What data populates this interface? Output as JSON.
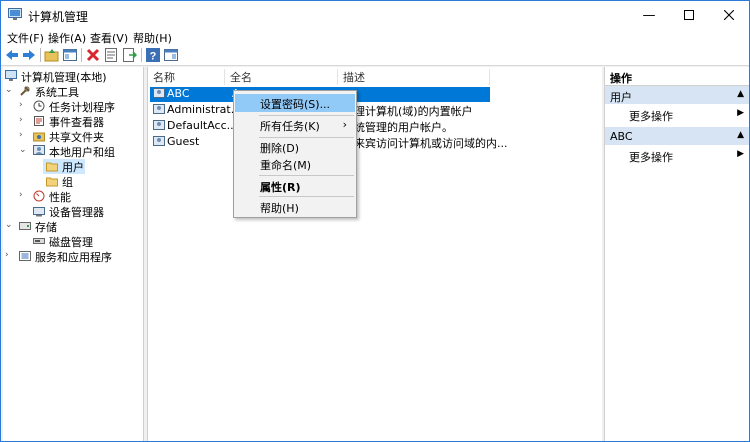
{
  "window": {
    "title": "计算机管理"
  },
  "menu": {
    "file": "文件(F)",
    "action": "操作(A)",
    "view": "查看(V)",
    "help": "帮助(H)"
  },
  "tree": {
    "root": "计算机管理(本地)",
    "system_tools": "系统工具",
    "task_scheduler": "任务计划程序",
    "event_viewer": "事件查看器",
    "shared_folders": "共享文件夹",
    "local_users_groups": "本地用户和组",
    "users": "用户",
    "groups": "组",
    "performance": "性能",
    "device_manager": "设备管理器",
    "storage": "存储",
    "disk_management": "磁盘管理",
    "services_apps": "服务和应用程序"
  },
  "list": {
    "columns": {
      "name": "名称",
      "fullname": "全名",
      "description": "描述"
    },
    "rows": [
      {
        "name": "ABC",
        "fullname": "A",
        "description": ""
      },
      {
        "name": "Administrat...",
        "fullname": "",
        "description": "管理计算机(域)的内置帐户"
      },
      {
        "name": "DefaultAcc...",
        "fullname": "",
        "description": "系统管理的用户帐户。"
      },
      {
        "name": "Guest",
        "fullname": "",
        "description": "供来宾访问计算机或访问域的内..."
      }
    ]
  },
  "actions": {
    "header": "操作",
    "section1": "用户",
    "more1": "更多操作",
    "section2": "ABC",
    "more2": "更多操作"
  },
  "context_menu": {
    "set_password": "设置密码(S)...",
    "all_tasks": "所有任务(K)",
    "delete": "删除(D)",
    "rename": "重命名(M)",
    "properties": "属性(R)",
    "help": "帮助(H)"
  }
}
